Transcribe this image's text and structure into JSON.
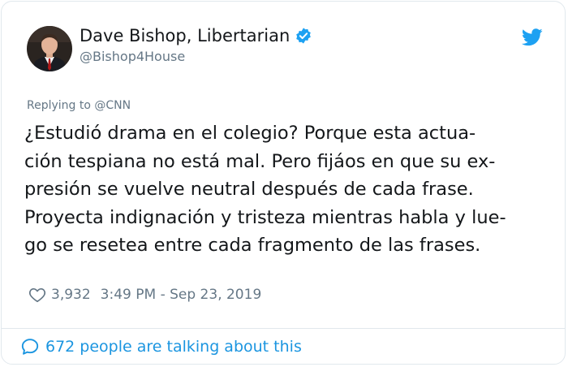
{
  "colors": {
    "accent": "#1da1f2",
    "link": "#1b95e0",
    "secondary_text": "#657786",
    "primary_text": "#14171a",
    "border": "#e1e8ed"
  },
  "author": {
    "display_name": "Dave Bishop, Libertarian",
    "handle": "@Bishop4House",
    "verified": true,
    "avatar_icon": "profile-photo"
  },
  "tweet": {
    "replying_to": "Replying to @CNN",
    "lines": [
      "¿Estudió drama en el colegio? Porque esta actua-",
      "ción tespiana no está mal. Pero fijáos en que su ex-",
      "presión se vuelve neutral después de cada frase.",
      "Proyecta indignación y tristeza mientras habla y lue-",
      "go se resetea entre cada fragmento de las frases."
    ],
    "like_count": "3,932",
    "timestamp": "3:49 PM - Sep 23, 2019"
  },
  "footer": {
    "conversation_text": "672 people are talking about this"
  },
  "icons": {
    "brand": "twitter-bird-icon",
    "verified": "verified-badge-icon",
    "like": "heart-icon",
    "reply": "speech-bubble-icon"
  }
}
